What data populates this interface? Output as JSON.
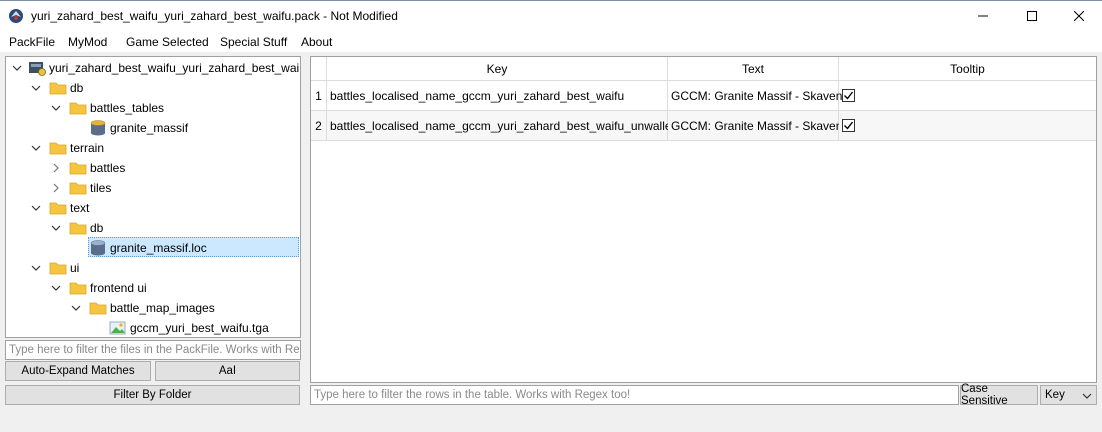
{
  "window": {
    "title": "yuri_zahard_best_waifu_yuri_zahard_best_waifu.pack - Not Modified",
    "minimize_icon": "minimize-icon",
    "maximize_icon": "maximize-icon",
    "close_icon": "close-icon"
  },
  "menu": [
    "PackFile",
    "MyMod",
    "Game Selected",
    "Special Stuff",
    "About"
  ],
  "tree": {
    "root": "yuri_zahard_best_waifu_yuri_zahard_best_wai...",
    "db": "db",
    "battles_tables": "battles_tables",
    "granite_massif": "granite_massif",
    "terrain": "terrain",
    "battles": "battles",
    "tiles": "tiles",
    "text": "text",
    "text_db": "db",
    "granite_massif_loc": "granite_massif.loc",
    "ui": "ui",
    "frontend_ui": "frontend ui",
    "battle_map_images": "battle_map_images",
    "tga": "gccm_yuri_best_waifu.tga"
  },
  "left_filter": {
    "placeholder": "Type here to filter the files in the PackFile. Works with Re..."
  },
  "buttons": {
    "auto_expand": "Auto-Expand Matches",
    "aai": "AaI",
    "filter_by_folder": "Filter By Folder",
    "case_sensitive": "Case Sensitive"
  },
  "table": {
    "headers": [
      "Key",
      "Text",
      "Tooltip"
    ],
    "rows": [
      {
        "num": "1",
        "key": "battles_localised_name_gccm_yuri_zahard_best_waifu",
        "text": "GCCM: Granite Massif - Skaven",
        "tooltip": true
      },
      {
        "num": "2",
        "key": "battles_localised_name_gccm_yuri_zahard_best_waifu_unwalled",
        "text": "GCCM: Granite Massif - Skaven",
        "tooltip": true
      }
    ]
  },
  "table_filter": {
    "placeholder": "Type here to filter the rows in the table. Works with Regex too!"
  },
  "column_select": {
    "value": "Key"
  },
  "colors": {
    "selection": "#cce8ff",
    "folder": "#f5c542",
    "db_icon": "#5a6d8a"
  }
}
